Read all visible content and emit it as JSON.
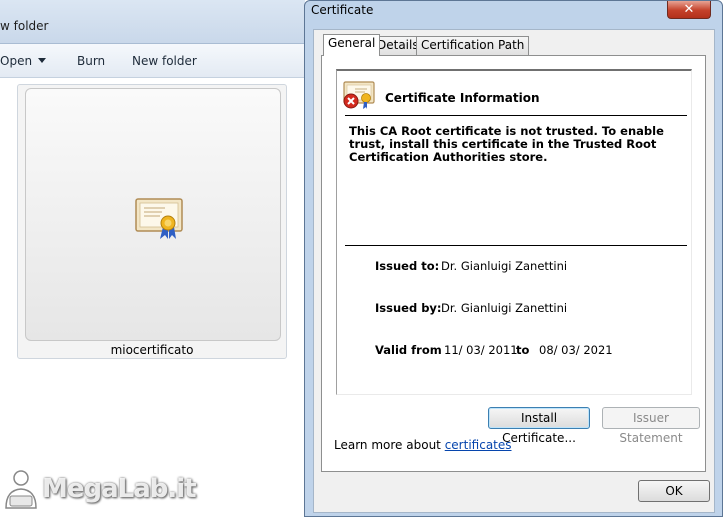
{
  "explorer": {
    "title_fragment": "w folder",
    "toolbar": {
      "open_label": "Open",
      "burn_label": "Burn",
      "new_folder_label": "New folder"
    },
    "file": {
      "name": "miocertificato",
      "icon": "certificate-icon"
    }
  },
  "dialog": {
    "title": "Certificate",
    "close_glyph": "✕",
    "tabs": [
      {
        "label": "General",
        "selected": true
      },
      {
        "label": "Details",
        "selected": false
      },
      {
        "label": "Certification Path",
        "selected": false
      }
    ],
    "info": {
      "heading": "Certificate Information",
      "icon": "certificate-error-icon",
      "warning": "This CA Root certificate is not trusted. To enable trust, install this certificate in the Trusted Root Certification Authorities store.",
      "issued_to_label": "Issued to:",
      "issued_to": "Dr. Gianluigi Zanettini",
      "issued_by_label": "Issued by:",
      "issued_by": "Dr. Gianluigi Zanettini",
      "valid_from_label": "Valid from",
      "valid_from": "11/ 03/ 2011",
      "valid_to_label": "to",
      "valid_to": "08/ 03/ 2021"
    },
    "buttons": {
      "install": "Install Certificate...",
      "issuer_statement": "Issuer Statement",
      "ok": "OK"
    },
    "learn_more_prefix": "Learn more about ",
    "learn_more_link": "certificates"
  },
  "watermark": {
    "text": "MegaLab.it"
  },
  "colors": {
    "dialog_frame": "#bfd3ea",
    "close_button": "#c4412a",
    "link": "#0645ad"
  }
}
